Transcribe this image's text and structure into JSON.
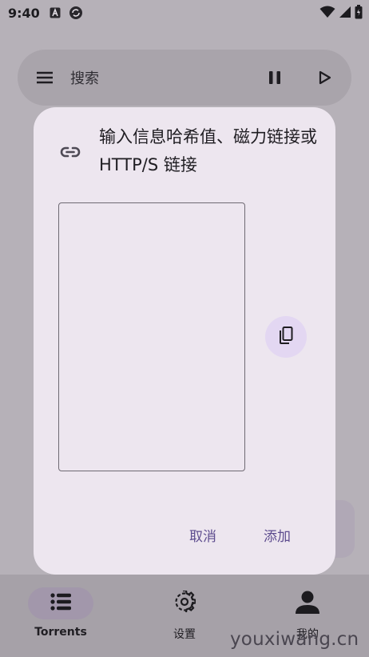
{
  "statusbar": {
    "time": "9:40"
  },
  "search": {
    "placeholder": "搜索"
  },
  "bottom_nav": {
    "items": [
      {
        "label": "Torrents",
        "active": true
      },
      {
        "label": "设置"
      },
      {
        "label": "我的"
      }
    ]
  },
  "dialog": {
    "title": "输入信息哈希值、磁力链接或 HTTP/S 链接",
    "input_value": "",
    "cancel_label": "取消",
    "add_label": "添加"
  },
  "watermark": "youxiwang.cn",
  "colors": {
    "dialog_bg": "#ede6ef",
    "accent": "#5e4d8f",
    "paste_button_bg": "#e3d7f2",
    "scrim": "#b6b1b8"
  }
}
